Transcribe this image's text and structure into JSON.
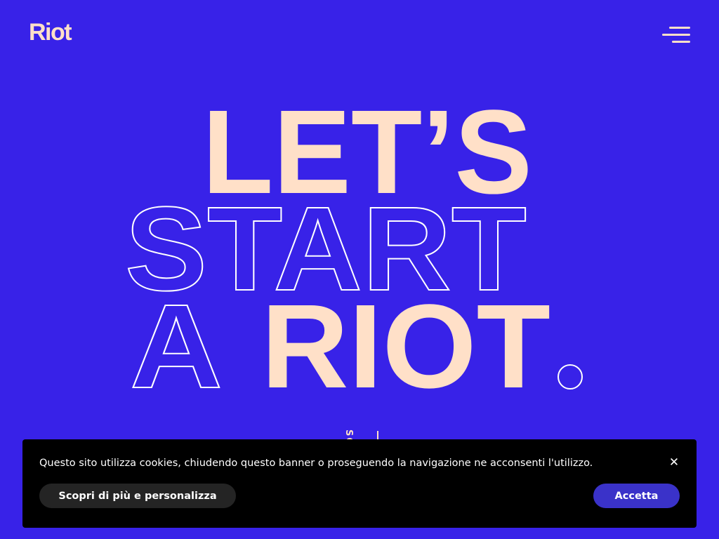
{
  "header": {
    "logo_text": "Riot",
    "menu_icon": "hamburger-menu-icon"
  },
  "hero": {
    "line1": "LET’S",
    "line2": "START",
    "line3_outline": "A",
    "line3_filled": "RIOT",
    "period_icon": "circle-dot-icon",
    "scroll_label": "SC"
  },
  "cookie_banner": {
    "message": "Questo sito utilizza cookies, chiudendo questo banner o proseguendo la navigazione ne acconsenti l'utilizzo.",
    "customize_label": "Scopri di più e personalizza",
    "accept_label": "Accetta",
    "close_glyph": "✕",
    "close_icon": "close-icon"
  },
  "colors": {
    "background": "#3822E8",
    "cream": "#FFE0C8",
    "banner_bg": "#000000",
    "customize_bg": "#242424",
    "accept_bg": "#3A32C9"
  }
}
